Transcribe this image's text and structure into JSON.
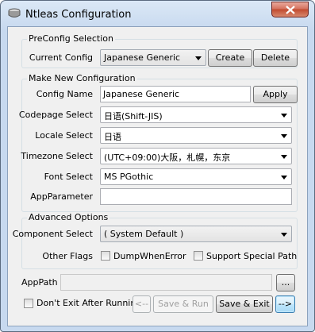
{
  "window": {
    "title": "Ntleas Configuration"
  },
  "preconfig": {
    "title": "PreConfig Selection",
    "current_label": "Current Config",
    "current_value": "Japanese Generic",
    "create_label": "Create",
    "delete_label": "Delete"
  },
  "newconfig": {
    "title": "Make New Configuration",
    "name_label": "Config Name",
    "name_value": "Japanese Generic",
    "apply_label": "Apply",
    "codepage_label": "Codepage Select",
    "codepage_value": "日语(Shift-JIS)",
    "locale_label": "Locale Select",
    "locale_value": "日语",
    "timezone_label": "Timezone Select",
    "timezone_value": "(UTC+09:00)大阪，札幌，东京",
    "font_label": "Font Select",
    "font_value": "MS PGothic",
    "param_label": "AppParameter",
    "param_value": ""
  },
  "advanced": {
    "title": "Advanced Options",
    "component_label": "Component Select",
    "component_value": "( System Default )",
    "flags_label": "Other Flags",
    "dump_label": "DumpWhenError",
    "special_label": "Support Special Path"
  },
  "footer": {
    "apppath_label": "AppPath",
    "apppath_value": "",
    "browse_label": "...",
    "noexit_label": "Don't Exit After Running",
    "back_label": "<--",
    "save_run_label": "Save & Run",
    "save_exit_label": "Save & Exit",
    "next_label": "-->"
  }
}
